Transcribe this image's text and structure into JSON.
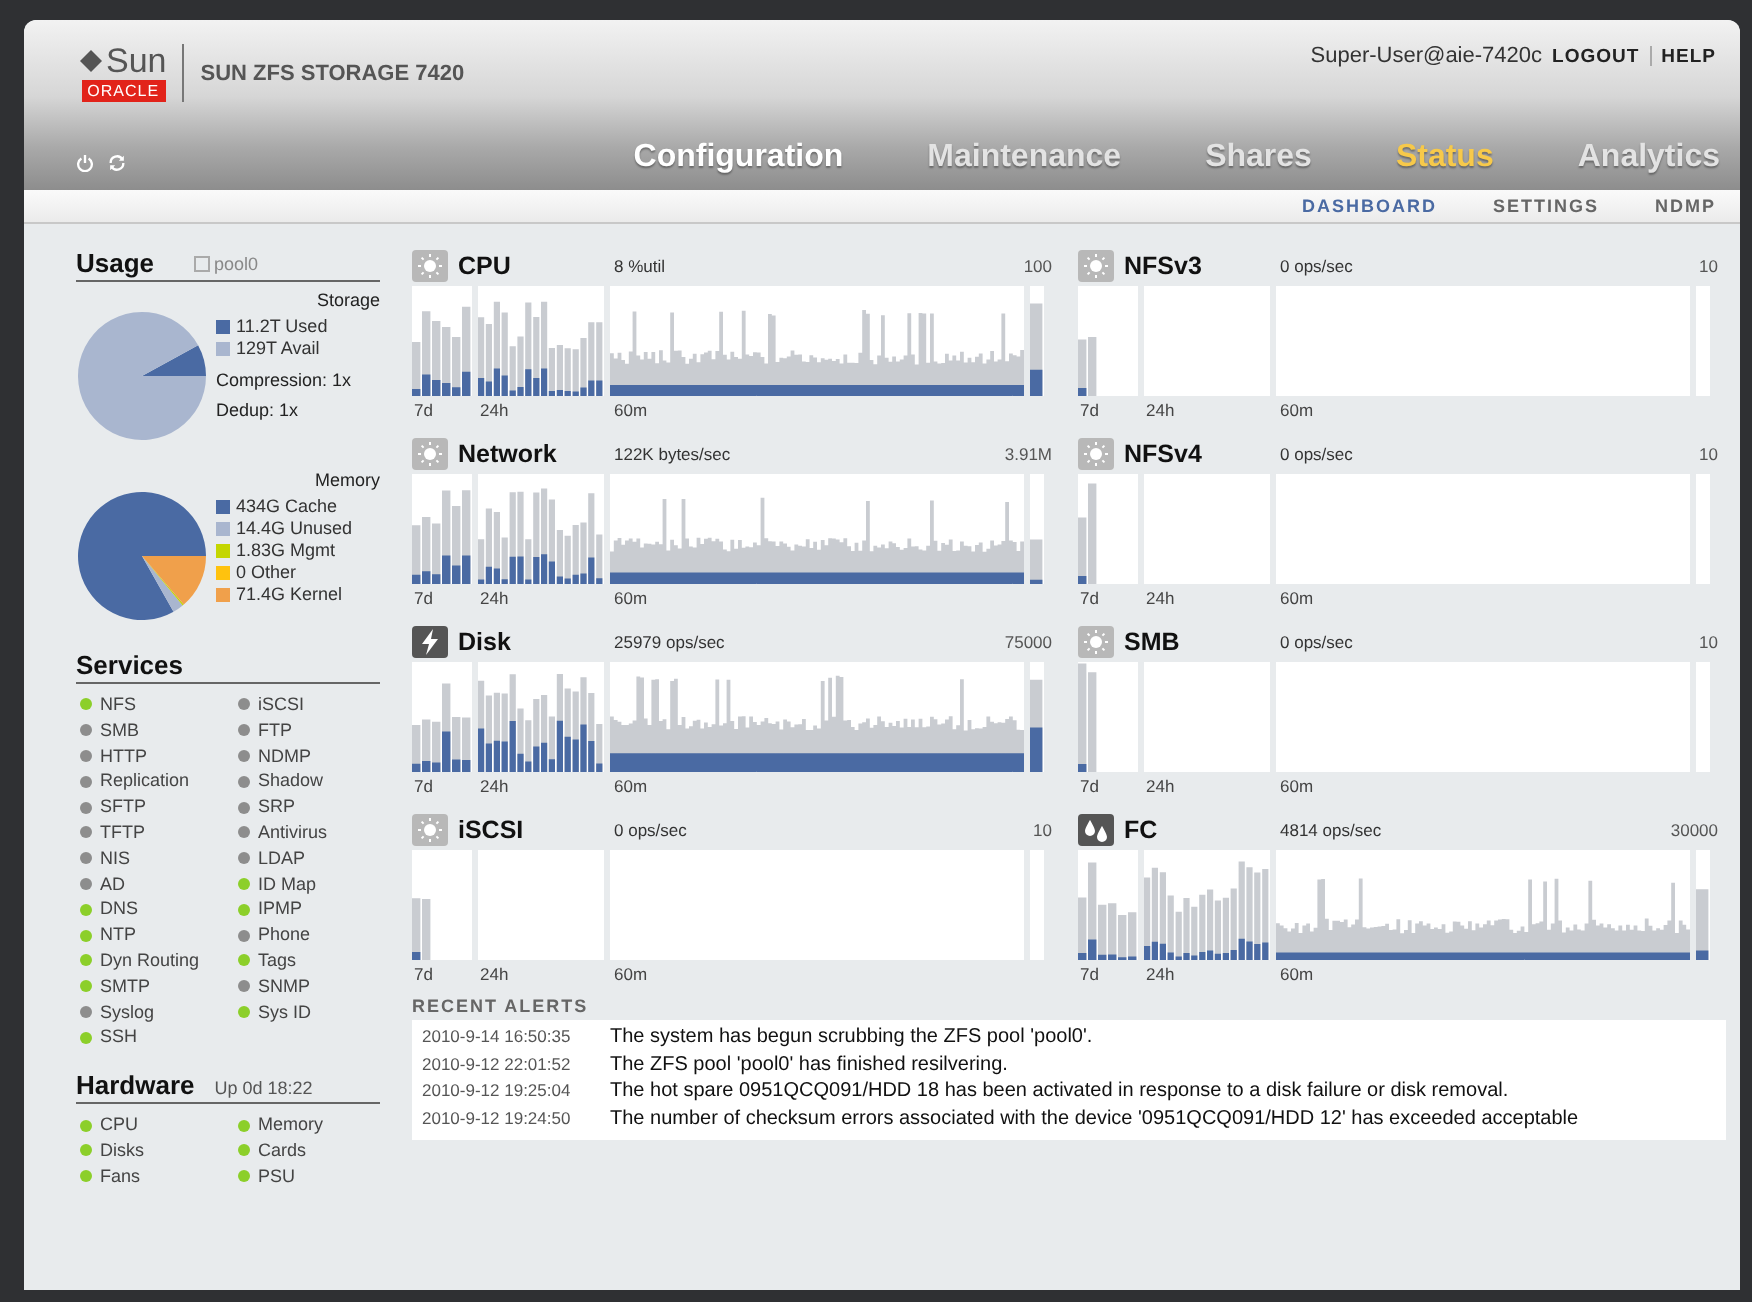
{
  "header": {
    "logo_sun": "Sun",
    "logo_oracle": "ORACLE",
    "product": "SUN ZFS STORAGE 7420",
    "user": "Super-User@aie-7420c",
    "logout": "LOGOUT",
    "help": "HELP"
  },
  "tabs": [
    {
      "label": "Configuration",
      "selected": false
    },
    {
      "label": "Maintenance",
      "selected": false
    },
    {
      "label": "Shares",
      "selected": false
    },
    {
      "label": "Status",
      "selected": true
    },
    {
      "label": "Analytics",
      "selected": false
    }
  ],
  "subtabs": [
    {
      "label": "DASHBOARD",
      "selected": true
    },
    {
      "label": "SETTINGS",
      "selected": false
    },
    {
      "label": "NDMP",
      "selected": false
    }
  ],
  "usage": {
    "title": "Usage",
    "pool": "pool0",
    "storage": {
      "title": "Storage",
      "chart_data": {
        "type": "pie",
        "categories": [
          "11.2T Used",
          "129T Avail"
        ],
        "values": [
          11.2,
          129
        ]
      },
      "legend": [
        {
          "color": "#4a6aa3"
        },
        {
          "color": "#a9b6cf"
        }
      ],
      "compression": "Compression: 1x",
      "dedup": "Dedup: 1x"
    },
    "memory": {
      "title": "Memory",
      "chart_data": {
        "type": "pie",
        "categories": [
          "434G Cache",
          "14.4G Unused",
          "1.83G Mgmt",
          "0 Other",
          "71.4G Kernel"
        ],
        "values": [
          434,
          14.4,
          1.83,
          0,
          71.4
        ]
      },
      "legend": [
        {
          "color": "#4a6aa3"
        },
        {
          "color": "#a9b6cf"
        },
        {
          "color": "#c4d600"
        },
        {
          "color": "#ffc20e"
        },
        {
          "color": "#f0a04b"
        }
      ]
    }
  },
  "services": {
    "title": "Services",
    "columns": [
      [
        {
          "label": "NFS",
          "on": true
        },
        {
          "label": "SMB",
          "on": false
        },
        {
          "label": "HTTP",
          "on": false
        },
        {
          "label": "Replication",
          "on": false
        },
        {
          "label": "SFTP",
          "on": false
        },
        {
          "label": "TFTP",
          "on": false
        },
        {
          "label": "NIS",
          "on": false
        },
        {
          "label": "AD",
          "on": false
        },
        {
          "label": "DNS",
          "on": true
        },
        {
          "label": "NTP",
          "on": true
        },
        {
          "label": "Dyn Routing",
          "on": true
        },
        {
          "label": "SMTP",
          "on": true
        },
        {
          "label": "Syslog",
          "on": false
        },
        {
          "label": "SSH",
          "on": true
        }
      ],
      [
        {
          "label": "iSCSI",
          "on": false
        },
        {
          "label": "FTP",
          "on": false
        },
        {
          "label": "NDMP",
          "on": false
        },
        {
          "label": "Shadow",
          "on": false
        },
        {
          "label": "SRP",
          "on": false
        },
        {
          "label": "Antivirus",
          "on": false
        },
        {
          "label": "LDAP",
          "on": false
        },
        {
          "label": "ID Map",
          "on": true
        },
        {
          "label": "IPMP",
          "on": true
        },
        {
          "label": "Phone",
          "on": false
        },
        {
          "label": "Tags",
          "on": true
        },
        {
          "label": "SNMP",
          "on": false
        },
        {
          "label": "Sys ID",
          "on": true
        }
      ]
    ]
  },
  "hardware": {
    "title": "Hardware",
    "uptime": "Up 0d 18:22",
    "columns": [
      [
        {
          "label": "CPU",
          "on": true
        },
        {
          "label": "Disks",
          "on": true
        },
        {
          "label": "Fans",
          "on": true
        }
      ],
      [
        {
          "label": "Memory",
          "on": true
        },
        {
          "label": "Cards",
          "on": true
        },
        {
          "label": "PSU",
          "on": true
        }
      ]
    ]
  },
  "graphs": [
    {
      "name": "CPU",
      "reading": "8 %util",
      "max": "100",
      "kind": "sunny",
      "idle": false,
      "ranges": [
        "7d",
        "24h",
        "60m"
      ]
    },
    {
      "name": "NFSv3",
      "reading": "0 ops/sec",
      "max": "10",
      "kind": "sunny",
      "idle": true,
      "ranges": [
        "7d",
        "24h",
        "60m"
      ]
    },
    {
      "name": "Network",
      "reading": "122K bytes/sec",
      "max": "3.91M",
      "kind": "sunny",
      "idle": false,
      "ranges": [
        "7d",
        "24h",
        "60m"
      ]
    },
    {
      "name": "NFSv4",
      "reading": "0 ops/sec",
      "max": "10",
      "kind": "sunny",
      "idle": true,
      "ranges": [
        "7d",
        "24h",
        "60m"
      ]
    },
    {
      "name": "Disk",
      "reading": "25979 ops/sec",
      "max": "75000",
      "kind": "storm",
      "idle": false,
      "ranges": [
        "7d",
        "24h",
        "60m"
      ]
    },
    {
      "name": "SMB",
      "reading": "0 ops/sec",
      "max": "10",
      "kind": "sunny",
      "idle": true,
      "ranges": [
        "7d",
        "24h",
        "60m"
      ]
    },
    {
      "name": "iSCSI",
      "reading": "0 ops/sec",
      "max": "10",
      "kind": "sunny",
      "idle": true,
      "ranges": [
        "7d",
        "24h",
        "60m"
      ]
    },
    {
      "name": "FC",
      "reading": "4814 ops/sec",
      "max": "30000",
      "kind": "rain",
      "idle": false,
      "ranges": [
        "7d",
        "24h",
        "60m"
      ]
    }
  ],
  "alerts": {
    "title": "RECENT ALERTS",
    "items": [
      {
        "time": "2010-9-14 16:50:35",
        "message": "The system has begun scrubbing the ZFS pool 'pool0'."
      },
      {
        "time": "2010-9-12 22:01:52",
        "message": "The ZFS pool 'pool0' has finished resilvering."
      },
      {
        "time": "2010-9-12 19:25:04",
        "message": "The hot spare 0951QCQ091/HDD 18 has been activated in response to a disk failure or disk removal."
      },
      {
        "time": "2010-9-12 19:24:50",
        "message": "The number of checksum errors associated with the device '0951QCQ091/HDD 12' has exceeded acceptable"
      }
    ]
  }
}
